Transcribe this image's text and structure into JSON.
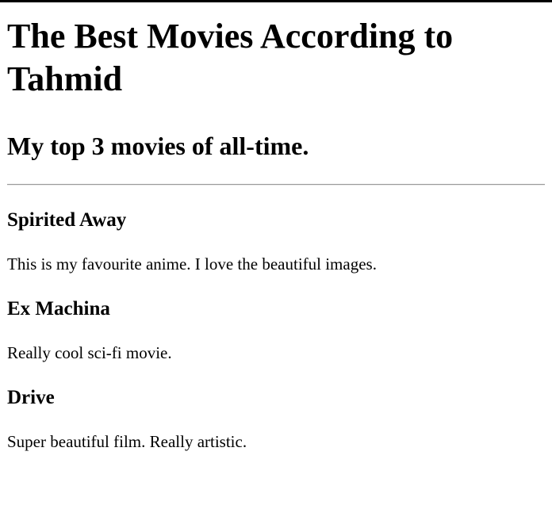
{
  "page": {
    "title": "The Best Movies According to Tahmid",
    "subtitle": "My top 3 movies of all-time."
  },
  "movies": [
    {
      "name": "Spirited Away",
      "description": "This is my favourite anime. I love the beautiful images."
    },
    {
      "name": "Ex Machina",
      "description": "Really cool sci-fi movie."
    },
    {
      "name": "Drive",
      "description": "Super beautiful film. Really artistic."
    }
  ]
}
